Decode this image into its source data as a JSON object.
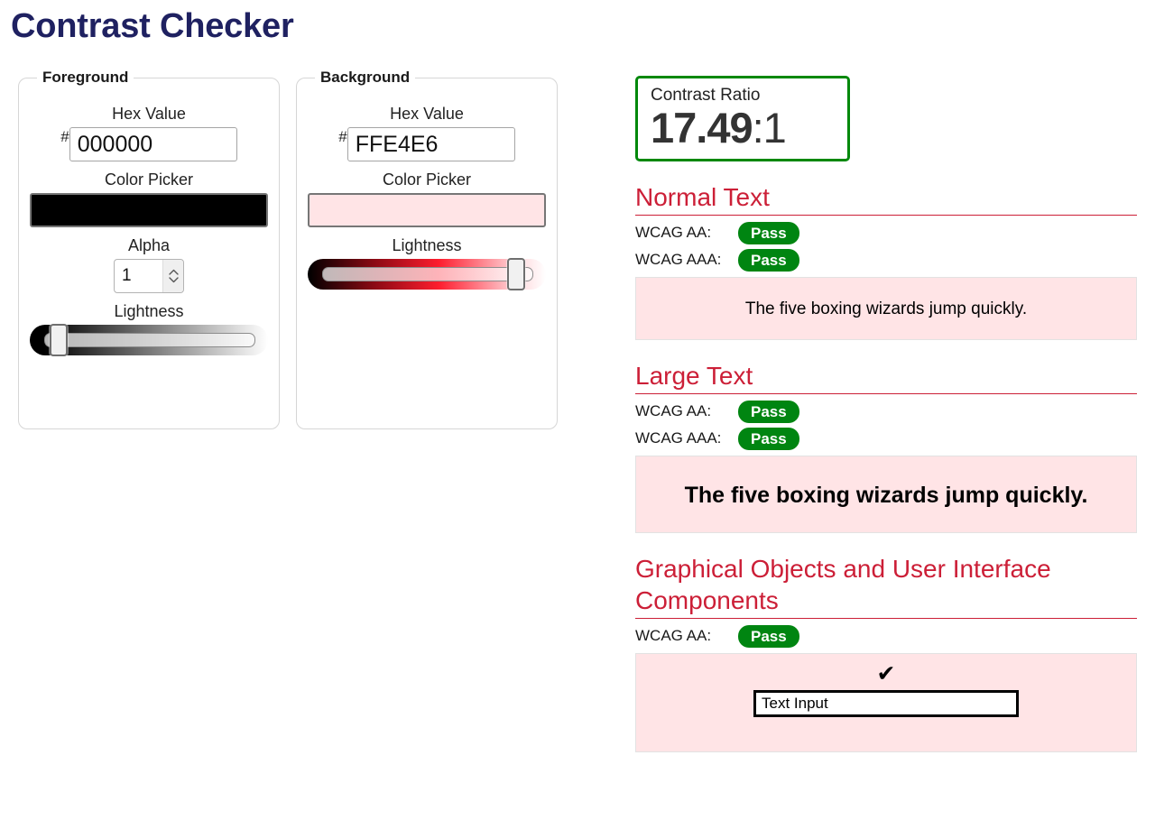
{
  "page": {
    "title": "Contrast Checker",
    "title_color": "#1f2161"
  },
  "foreground": {
    "legend": "Foreground",
    "hex_label": "Hex Value",
    "hash_symbol": "#",
    "hex_value": "000000",
    "hex_placeholder": "000000",
    "picker_label": "Color Picker",
    "picker_color": "#000000",
    "alpha_label": "Alpha",
    "alpha_value": "1",
    "lightness_label": "Lightness",
    "lightness_percent": 7
  },
  "background": {
    "legend": "Background",
    "hex_label": "Hex Value",
    "hash_symbol": "#",
    "hex_value": "FFE4E6",
    "hex_placeholder": "FFE4E6",
    "picker_label": "Color Picker",
    "picker_color": "#FFE4E6",
    "lightness_label": "Lightness",
    "lightness_percent": 92
  },
  "results": {
    "ratio": {
      "label": "Contrast Ratio",
      "value": "17.49",
      "suffix": ":1",
      "border_color": "#00880b"
    },
    "sections": [
      {
        "title": "Normal Text",
        "criteria": [
          {
            "label": "WCAG AA:",
            "status": "Pass",
            "status_color": "#008511"
          },
          {
            "label": "WCAG AAA:",
            "status": "Pass",
            "status_color": "#008511"
          }
        ],
        "sample_text": "The five boxing wizards jump quickly."
      },
      {
        "title": "Large Text",
        "criteria": [
          {
            "label": "WCAG AA:",
            "status": "Pass",
            "status_color": "#008511"
          },
          {
            "label": "WCAG AAA:",
            "status": "Pass",
            "status_color": "#008511"
          }
        ],
        "sample_text": "The five boxing wizards jump quickly."
      },
      {
        "title": "Graphical Objects and User Interface Components",
        "criteria": [
          {
            "label": "WCAG AA:",
            "status": "Pass",
            "status_color": "#008511"
          }
        ],
        "check_glyph": "✔",
        "input_value": "Text Input"
      }
    ],
    "heading_color": "#cc1f37",
    "sample_bg": "#ffe4e6",
    "sample_fg": "#000000"
  }
}
